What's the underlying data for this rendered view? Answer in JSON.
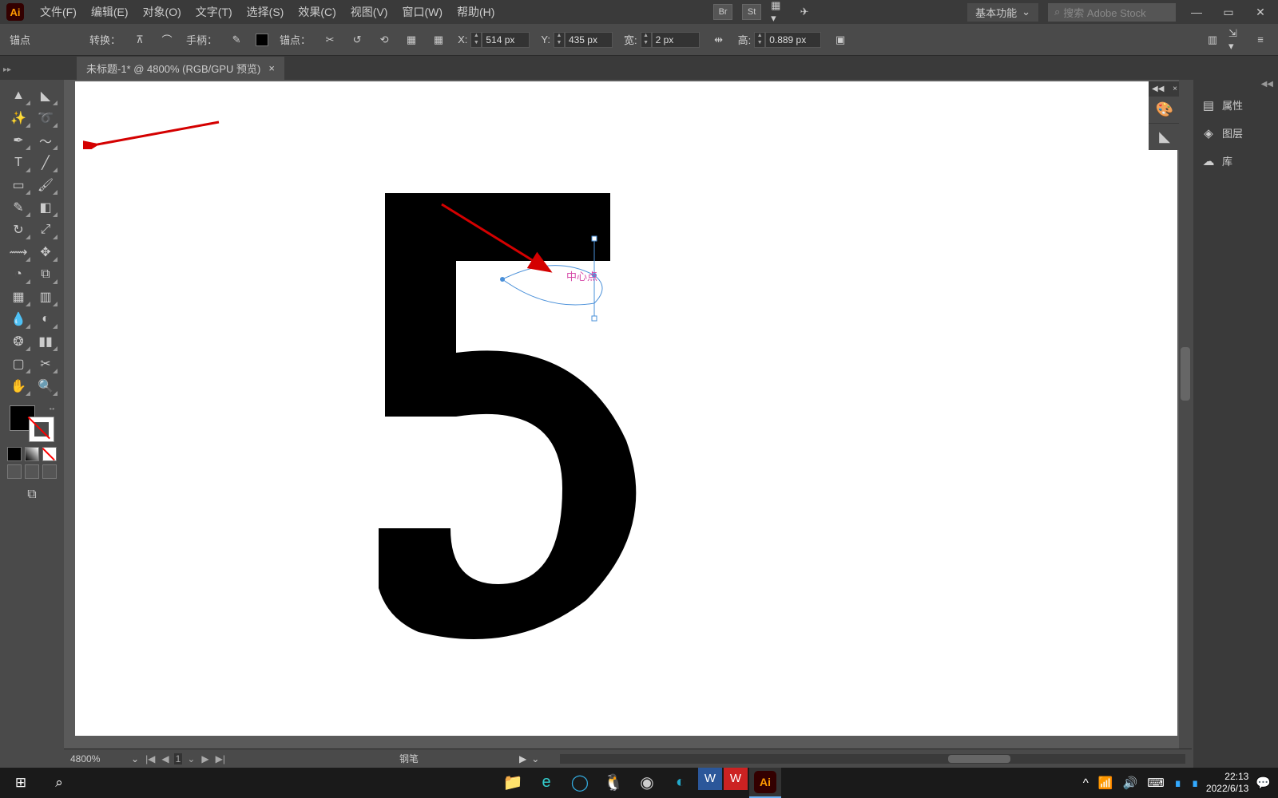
{
  "app_logo": "Ai",
  "menu": {
    "file": "文件(F)",
    "edit": "编辑(E)",
    "object": "对象(O)",
    "type": "文字(T)",
    "select": "选择(S)",
    "effect": "效果(C)",
    "view": "视图(V)",
    "window": "窗口(W)",
    "help": "帮助(H)"
  },
  "workspace": {
    "selector": "基本功能",
    "search_placeholder": "搜索 Adobe Stock"
  },
  "control": {
    "anchor_label": "锚点",
    "convert_label": "转换：",
    "handle_label": "手柄：",
    "anchors_label": "锚点：",
    "x_label": "X:",
    "x_value": "514 px",
    "y_label": "Y:",
    "y_value": "435 px",
    "w_label": "宽:",
    "w_value": "2 px",
    "h_label": "高:",
    "h_value": "0.889 px"
  },
  "tab": {
    "title": "未标题-1* @ 4800% (RGB/GPU 预览)"
  },
  "canvas": {
    "anchor_hint": "中心点"
  },
  "right_panels": {
    "props": "属性",
    "layers": "图层",
    "lib": "库"
  },
  "status": {
    "zoom": "4800%",
    "artboard": "1",
    "tool": "钢笔"
  },
  "taskbar": {
    "time": "22:13",
    "date": "2022/6/13"
  }
}
